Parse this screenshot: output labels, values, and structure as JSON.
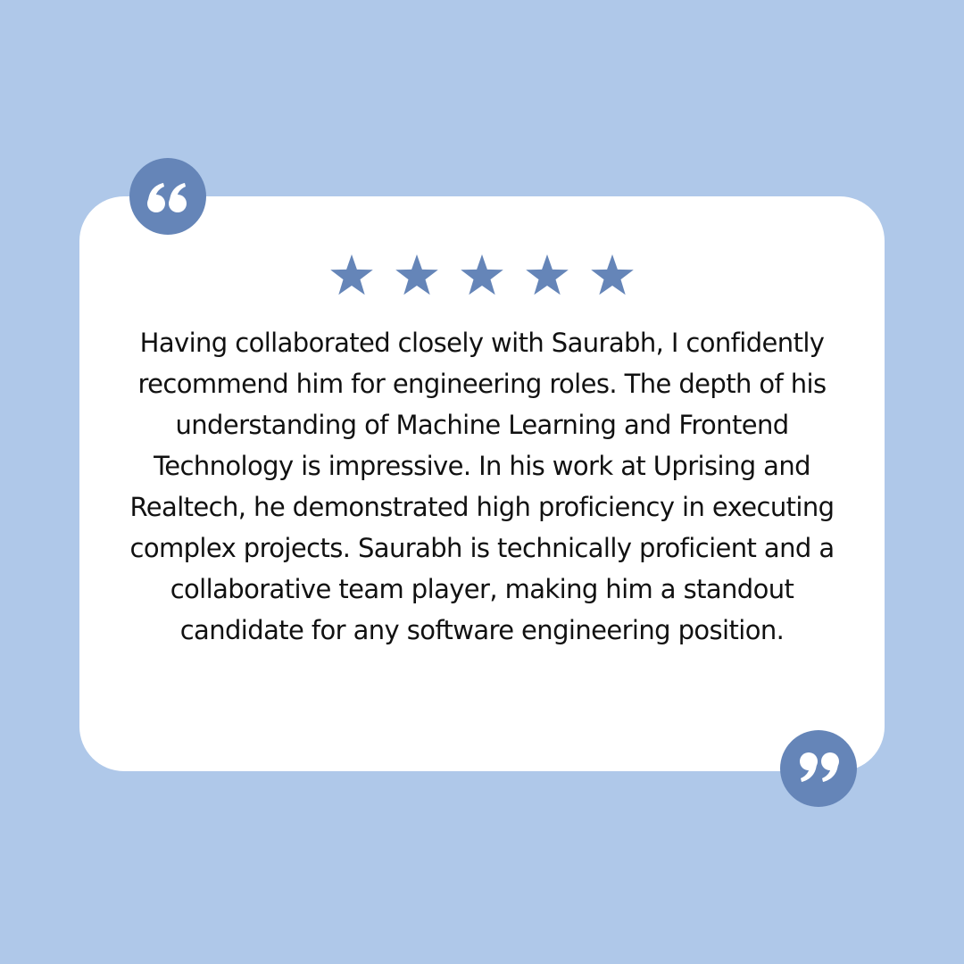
{
  "review": {
    "rating": 5,
    "rating_max": 5,
    "text": "Having collaborated closely with Saurabh, I confidently recommend him for engineering roles. The depth of his understanding of Machine Learning and Frontend Technology is impressive. In his work at Uprising and Realtech, he demonstrated high proficiency in executing complex projects. Saurabh is technically proficient and a collaborative team player, making him a standout candidate for any software engineering position."
  },
  "icons": {
    "open_quote": "open-quote-icon",
    "close_quote": "close-quote-icon",
    "star": "star-icon"
  },
  "colors": {
    "background": "#afc8e9",
    "card": "#ffffff",
    "accent": "#6585b8",
    "text": "#111111"
  }
}
